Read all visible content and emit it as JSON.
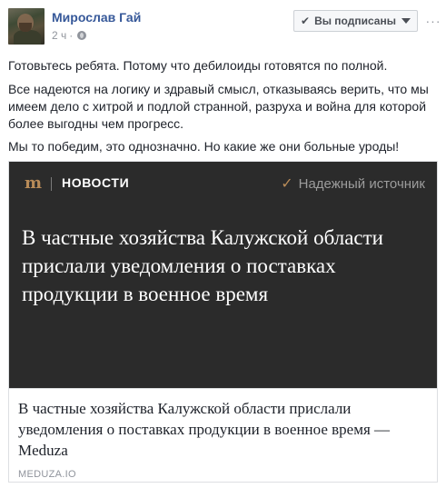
{
  "post": {
    "author": "Мирослав Гай",
    "time": "2 ч",
    "privacy_icon": "globe-icon",
    "subscribe_button": {
      "label": "Вы подписаны",
      "icon": "check-icon"
    },
    "more_icon": "more-options-icon",
    "paragraphs": [
      "Готовьтесь ребята. Потому что дебилоиды готовятся по полной.",
      "Все надеются на логику и здравый смысл, отказываясь верить, что мы имеем дело с хитрой и подлой странной, разруха и война для которой более выгодны чем прогресс.",
      "Мы то победим, это однозначно. Но какие же они больные уроды!"
    ]
  },
  "link_preview": {
    "image": {
      "logo": "m",
      "section": "НОВОСТИ",
      "trusted_label": "Надежный источник",
      "headline": "В частные хозяйства Калужской области прислали уведомления о поставках продукции в военное время"
    },
    "title": "В частные хозяйства Калужской области прислали уведомления о поставках продукции в военное время — Meduza",
    "domain": "MEDUZA.IO"
  },
  "colors": {
    "author_link": "#365899",
    "meduza_gold": "#b88b58",
    "image_bg": "#2b2b2b",
    "meta_gray": "#90949c"
  }
}
